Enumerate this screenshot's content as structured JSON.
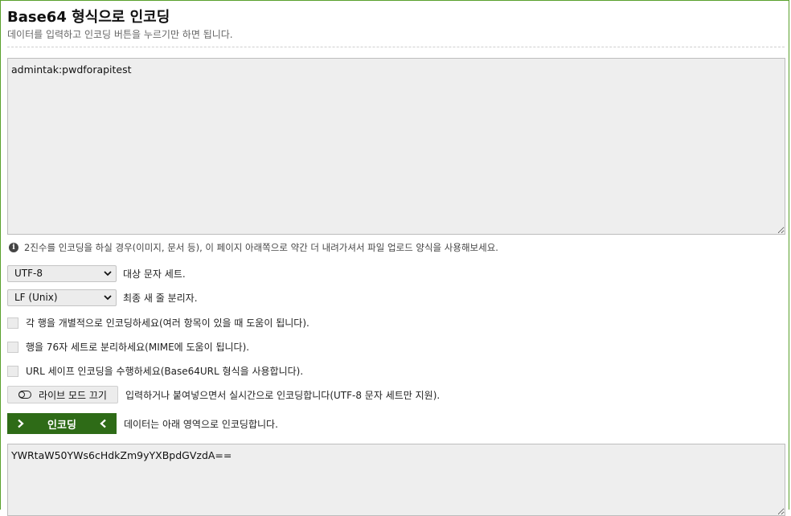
{
  "header": {
    "title": "Base64 형식으로 인코딩",
    "subtitle": "데이터를 입력하고 인코딩 버튼을 누르기만 하면 됩니다."
  },
  "input": {
    "value": "admintak:pwdforapitest"
  },
  "hint": {
    "text": "2진수를 인코딩을 하실 경우(이미지, 문서 등), 이 페이지 아래쪽으로 약간 더 내려가셔서 파일 업로드 양식을 사용해보세요."
  },
  "options": {
    "charset": {
      "selected": "UTF-8",
      "label": "대상 문자 세트."
    },
    "newline": {
      "selected": "LF (Unix)",
      "label": "최종 새 줄 분리자."
    },
    "each_line": {
      "label": "각 행을 개별적으로 인코딩하세요(여러 항목이 있을 때 도움이 됩니다).",
      "checked": false
    },
    "split_lines": {
      "label": "행을 76자 세트로 분리하세요(MIME에 도움이 됩니다).",
      "checked": false
    },
    "url_safe": {
      "label": "URL 세이프 인코딩을 수행하세요(Base64URL 형식을 사용합니다).",
      "checked": false
    }
  },
  "live_mode": {
    "button_label": "라이브 모드 끄기",
    "description": "입력하거나 붙여넣으면서 실시간으로 인코딩합니다(UTF-8 문자 세트만 지원)."
  },
  "encode": {
    "button_label": "인코딩",
    "description": "데이터는 아래 영역으로 인코딩합니다."
  },
  "output": {
    "value": "YWRtaW50YWs6cHdkZm9yYXBpdGVzdA=="
  },
  "colors": {
    "accent_border": "#5aa02c",
    "encode_button": "#2e6b17"
  }
}
